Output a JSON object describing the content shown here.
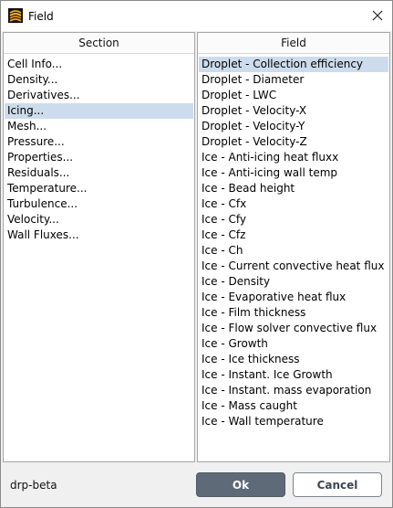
{
  "window": {
    "title": "Field"
  },
  "section_panel": {
    "header": "Section",
    "items": [
      {
        "label": "Cell Info..."
      },
      {
        "label": "Density..."
      },
      {
        "label": "Derivatives..."
      },
      {
        "label": "Icing..."
      },
      {
        "label": "Mesh..."
      },
      {
        "label": "Pressure..."
      },
      {
        "label": "Properties..."
      },
      {
        "label": "Residuals..."
      },
      {
        "label": "Temperature..."
      },
      {
        "label": "Turbulence..."
      },
      {
        "label": "Velocity..."
      },
      {
        "label": "Wall Fluxes..."
      }
    ],
    "selected_index": 3
  },
  "field_panel": {
    "header": "Field",
    "items": [
      {
        "label": "Droplet - Collection efficiency"
      },
      {
        "label": "Droplet - Diameter"
      },
      {
        "label": "Droplet - LWC"
      },
      {
        "label": "Droplet - Velocity-X"
      },
      {
        "label": "Droplet - Velocity-Y"
      },
      {
        "label": "Droplet - Velocity-Z"
      },
      {
        "label": "Ice - Anti-icing heat fluxx"
      },
      {
        "label": "Ice - Anti-icing wall temp"
      },
      {
        "label": "Ice - Bead height"
      },
      {
        "label": "Ice - Cfx"
      },
      {
        "label": "Ice - Cfy"
      },
      {
        "label": "Ice - Cfz"
      },
      {
        "label": "Ice - Ch"
      },
      {
        "label": "Ice - Current convective heat flux"
      },
      {
        "label": "Ice - Density"
      },
      {
        "label": "Ice - Evaporative heat flux"
      },
      {
        "label": "Ice - Film thickness"
      },
      {
        "label": "Ice - Flow solver convective flux"
      },
      {
        "label": "Ice - Growth"
      },
      {
        "label": "Ice - Ice thickness"
      },
      {
        "label": "Ice - Instant. Ice Growth"
      },
      {
        "label": "Ice - Instant. mass evaporation"
      },
      {
        "label": "Ice - Mass caught"
      },
      {
        "label": "Ice - Wall temperature"
      }
    ],
    "selected_index": 0
  },
  "footer": {
    "label": "drp-beta",
    "ok_label": "Ok",
    "cancel_label": "Cancel"
  },
  "colors": {
    "selection": "#cddcec",
    "ok_button": "#5f6a78",
    "cancel_border": "#7d858f"
  },
  "icons": {
    "app": "app-logo-icon",
    "close": "close-icon"
  }
}
